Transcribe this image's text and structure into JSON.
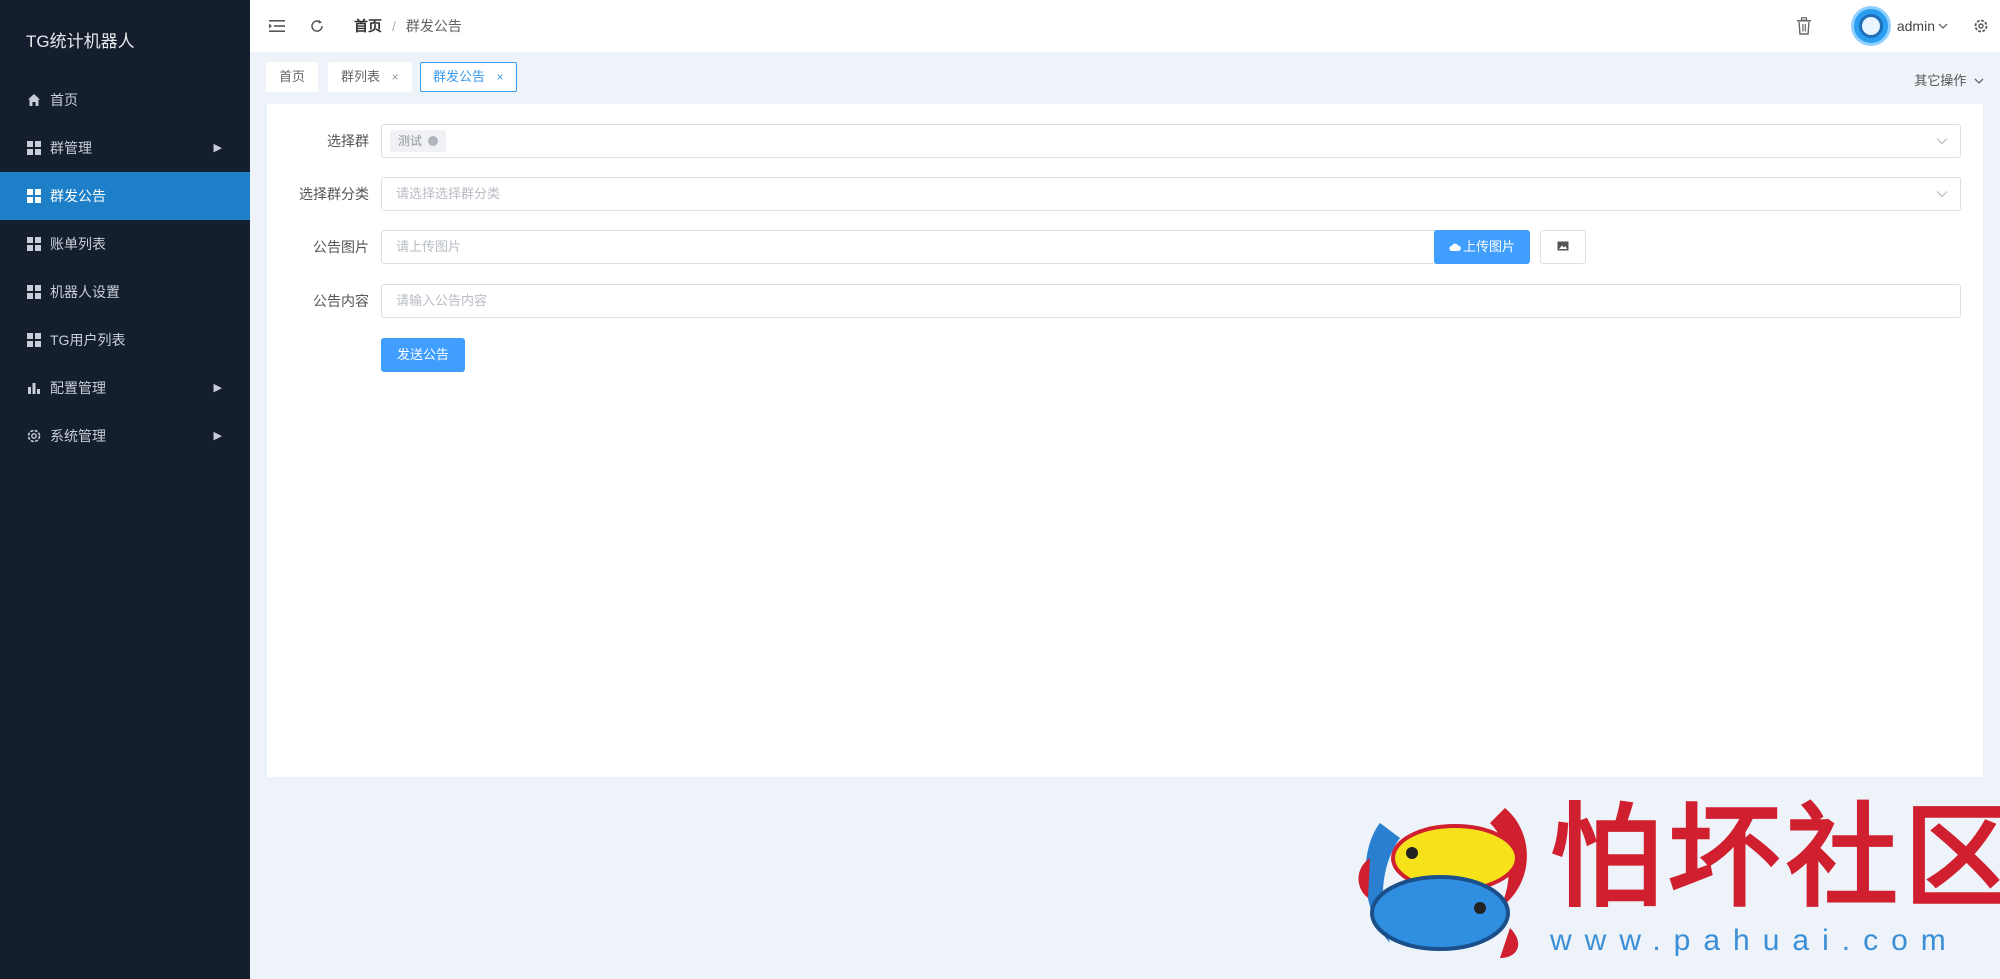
{
  "app": {
    "title": "TG统计机器人"
  },
  "sidebar": {
    "items": [
      {
        "label": "首页",
        "icon": "home-icon",
        "expandable": false,
        "active": false
      },
      {
        "label": "群管理",
        "icon": "grid-icon",
        "expandable": true,
        "active": false
      },
      {
        "label": "群发公告",
        "icon": "grid-icon",
        "expandable": false,
        "active": true
      },
      {
        "label": "账单列表",
        "icon": "grid-icon",
        "expandable": false,
        "active": false
      },
      {
        "label": "机器人设置",
        "icon": "grid-icon",
        "expandable": false,
        "active": false
      },
      {
        "label": "TG用户列表",
        "icon": "grid-icon",
        "expandable": false,
        "active": false
      },
      {
        "label": "配置管理",
        "icon": "bar-chart-icon",
        "expandable": true,
        "active": false
      },
      {
        "label": "系统管理",
        "icon": "gear-icon",
        "expandable": true,
        "active": false
      }
    ]
  },
  "header": {
    "breadcrumb": {
      "home": "首页",
      "separator": "/",
      "current": "群发公告"
    },
    "user": {
      "name": "admin"
    }
  },
  "tabs": [
    {
      "label": "首页",
      "closable": false,
      "active": false
    },
    {
      "label": "群列表",
      "closable": true,
      "active": false
    },
    {
      "label": "群发公告",
      "closable": true,
      "active": true
    }
  ],
  "tabs_close_glyph": "×",
  "other_ops": {
    "label": "其它操作"
  },
  "form": {
    "select_group": {
      "label": "选择群",
      "selected_tag": "测试"
    },
    "group_category": {
      "label": "选择群分类",
      "placeholder": "请选择选择群分类"
    },
    "image": {
      "label": "公告图片",
      "placeholder": "请上传图片",
      "upload_label": "上传图片"
    },
    "content": {
      "label": "公告内容",
      "placeholder": "请输入公告内容"
    },
    "submit_label": "发送公告"
  },
  "watermark": {
    "title": "怕坏社区",
    "url": "www.pahuai.com"
  },
  "colors": {
    "sidebar_bg": "#141e2d",
    "sidebar_active": "#1d7fc7",
    "primary": "#409eff",
    "page_bg": "#eef2f9",
    "watermark_red": "#d01f2e",
    "watermark_blue": "#3b8fd6"
  }
}
